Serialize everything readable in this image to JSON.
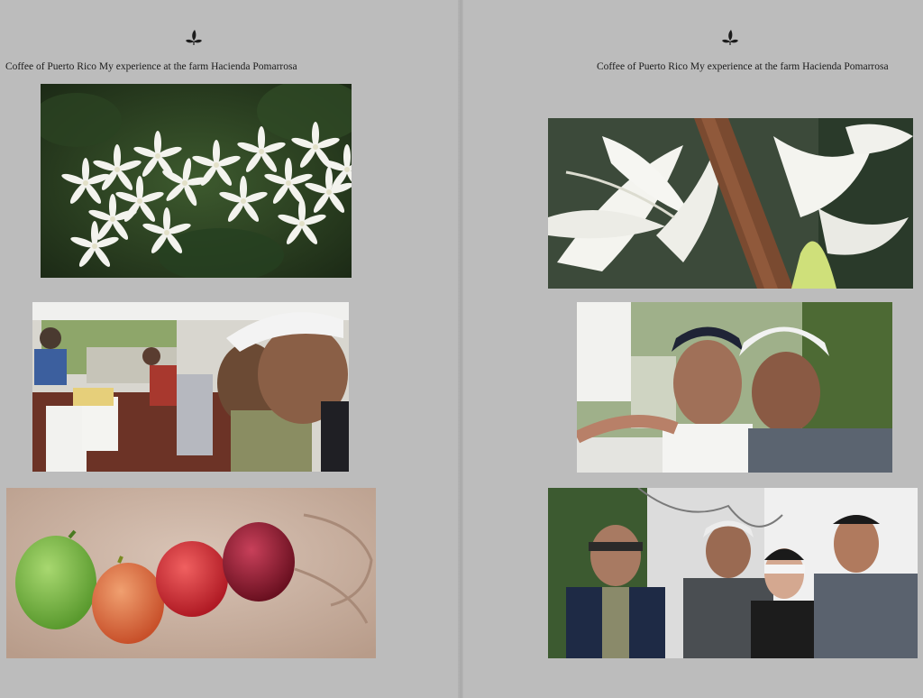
{
  "left_page": {
    "header": "Coffee of Puerto Rico My experience at the farm Hacienda Pomarrosa",
    "ornament_icon": "leaf-ornament-icon",
    "photos": [
      {
        "id": "coffee-blossoms"
      },
      {
        "id": "sorting-coffee-selfie"
      },
      {
        "id": "coffee-cherries-hand"
      }
    ]
  },
  "right_page": {
    "header": "Coffee of Puerto Rico My experience at the farm Hacienda Pomarrosa",
    "ornament_icon": "leaf-ornament-icon",
    "photos": [
      {
        "id": "blossom-closeup"
      },
      {
        "id": "two-men-selfie"
      },
      {
        "id": "group-photo"
      }
    ]
  },
  "colors": {
    "page_bg": "#bcbcbc",
    "text": "#1a1a1a"
  }
}
